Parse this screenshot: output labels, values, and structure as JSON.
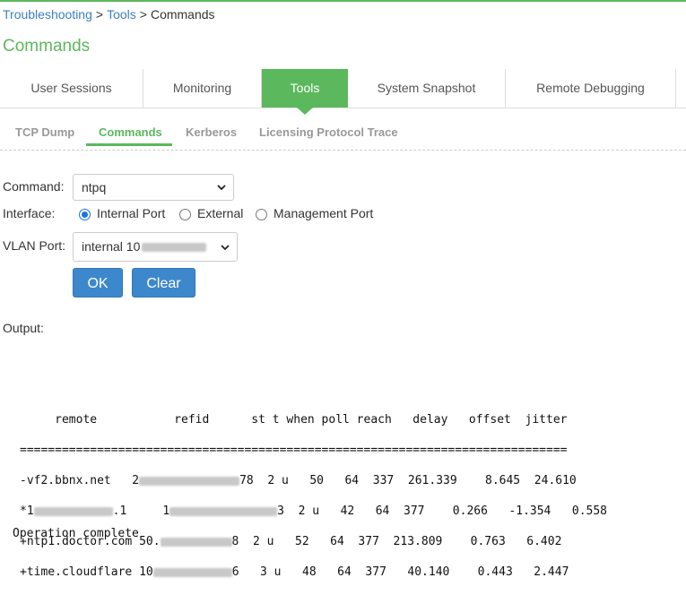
{
  "breadcrumb": {
    "item1": "Troubleshooting",
    "item2": "Tools",
    "current": "Commands",
    "separator": ">"
  },
  "page_title": "Commands",
  "main_tabs": [
    {
      "label": "User Sessions"
    },
    {
      "label": "Monitoring"
    },
    {
      "label": "Tools",
      "active": true
    },
    {
      "label": "System Snapshot"
    },
    {
      "label": "Remote Debugging"
    }
  ],
  "sub_tabs": [
    {
      "label": "TCP Dump"
    },
    {
      "label": "Commands",
      "active": true
    },
    {
      "label": "Kerberos"
    },
    {
      "label": "Licensing Protocol Trace"
    }
  ],
  "form": {
    "command_label": "Command:",
    "command_value": "ntpq",
    "interface_label": "Interface:",
    "interface_options": [
      "Internal Port",
      "External",
      "Management Port"
    ],
    "interface_selected": "Internal Port",
    "vlan_label": "VLAN Port:",
    "vlan_value_prefix": "internal 10",
    "ok_label": "OK",
    "clear_label": "Clear"
  },
  "output_label": "Output:",
  "ntpq": {
    "header": "     remote           refid      st t when poll reach   delay   offset  jitter",
    "divider": "==============================================================================",
    "rows": [
      {
        "pre": "-vf2.bbnx.net   ",
        "refid_visible": "2",
        "refid_suffix": "78",
        "rest": "  2 u   50   64  337  261.339    8.645  24.610"
      },
      {
        "pre": "*1",
        "pre_suffix": ".1",
        "refid_visible": "1",
        "refid_suffix": "3",
        "rest": "  2 u   42   64  377    0.266   -1.354   0.558"
      },
      {
        "pre": "+ntp1.doctor.com ",
        "refid_visible": "50.",
        "refid_suffix": "8",
        "rest": "  2 u   52   64  377  213.809    0.763   6.402"
      },
      {
        "pre": "+time.cloudflare ",
        "refid_visible": "10",
        "refid_suffix": "6",
        "rest": "   3 u   48   64  377   40.140    0.443   2.447"
      }
    ]
  },
  "status": "Operation complete",
  "colors": {
    "accent": "#5cb85c",
    "link": "#3a7fc1",
    "button": "#3d88cc",
    "radio": "#1a73e8"
  }
}
